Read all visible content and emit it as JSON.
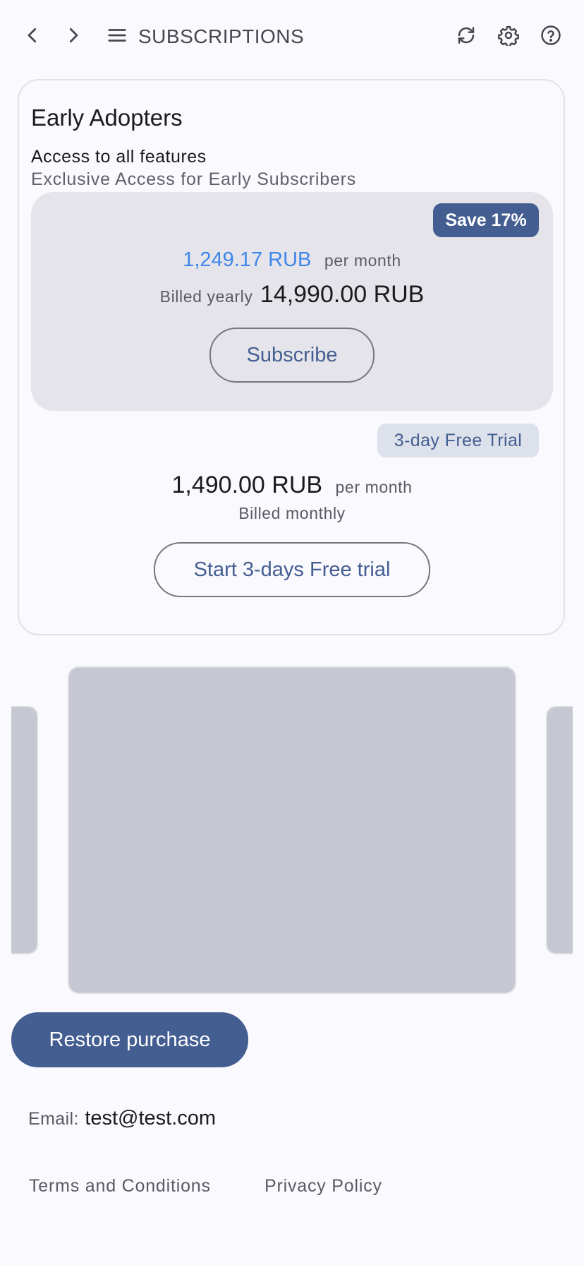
{
  "header": {
    "title": "SUBSCRIPTIONS",
    "icons": [
      "back-icon",
      "forward-icon",
      "menu-icon",
      "refresh-icon",
      "gear-icon",
      "help-icon"
    ]
  },
  "plan": {
    "name": "Early Adopters",
    "feature": "Access to all features",
    "description": "Exclusive Access for Early Subscribers",
    "yearly": {
      "badge": "Save 17%",
      "monthly_equivalent": "1,249.17 RUB",
      "per_month": "per month",
      "billed_label": "Billed yearly",
      "billed_price": "14,990.00 RUB",
      "button": "Subscribe"
    },
    "monthly": {
      "badge": "3-day Free Trial",
      "price": "1,490.00 RUB",
      "per_month": "per month",
      "billed_label": "Billed monthly",
      "button": "Start 3-days Free trial"
    }
  },
  "footer": {
    "restore_button": "Restore purchase",
    "email_label": "Email:",
    "email_value": "test@test.com",
    "terms": "Terms and Conditions",
    "privacy": "Privacy Policy"
  },
  "colors": {
    "primary": "#445e91",
    "price_accent": "#3f86ea",
    "background": "#f9f9fe",
    "tile": "#c5c8d0"
  }
}
